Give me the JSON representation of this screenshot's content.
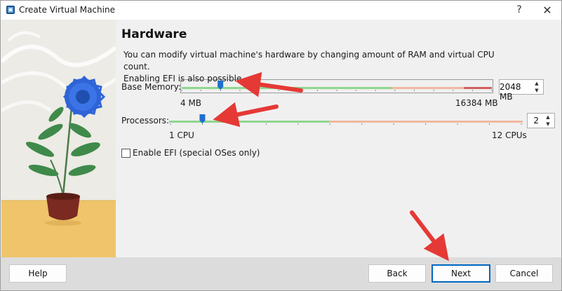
{
  "window": {
    "title": "Create Virtual Machine",
    "help_glyph": "?",
    "close_glyph": "✕"
  },
  "page": {
    "title": "Hardware",
    "description_line1": "You can modify virtual machine's hardware by changing amount of RAM and virtual CPU count.",
    "description_line2": "Enabling EFI is also possible."
  },
  "memory": {
    "label": "Base Memory:",
    "min_label": "4 MB",
    "max_label": "16384 MB",
    "value": "2048 MB",
    "value_mb": 2048,
    "min_mb": 4,
    "max_mb": 16384
  },
  "processors": {
    "label": "Processors:",
    "min_label": "1 CPU",
    "max_label": "12 CPUs",
    "value": "2",
    "value_count": 2,
    "min_count": 1,
    "max_count": 12
  },
  "efi": {
    "label": "Enable EFI (special OSes only)",
    "checked": false
  },
  "buttons": {
    "help": "Help",
    "back": "Back",
    "next": "Next",
    "cancel": "Cancel"
  },
  "colors": {
    "accent": "#0067c0",
    "slider_handle": "#1e6fd0",
    "track_ok": "#8fd68f",
    "track_bad": "#f0b8a0",
    "track_warn": "#d06060",
    "annotation_arrow": "#e53935"
  }
}
